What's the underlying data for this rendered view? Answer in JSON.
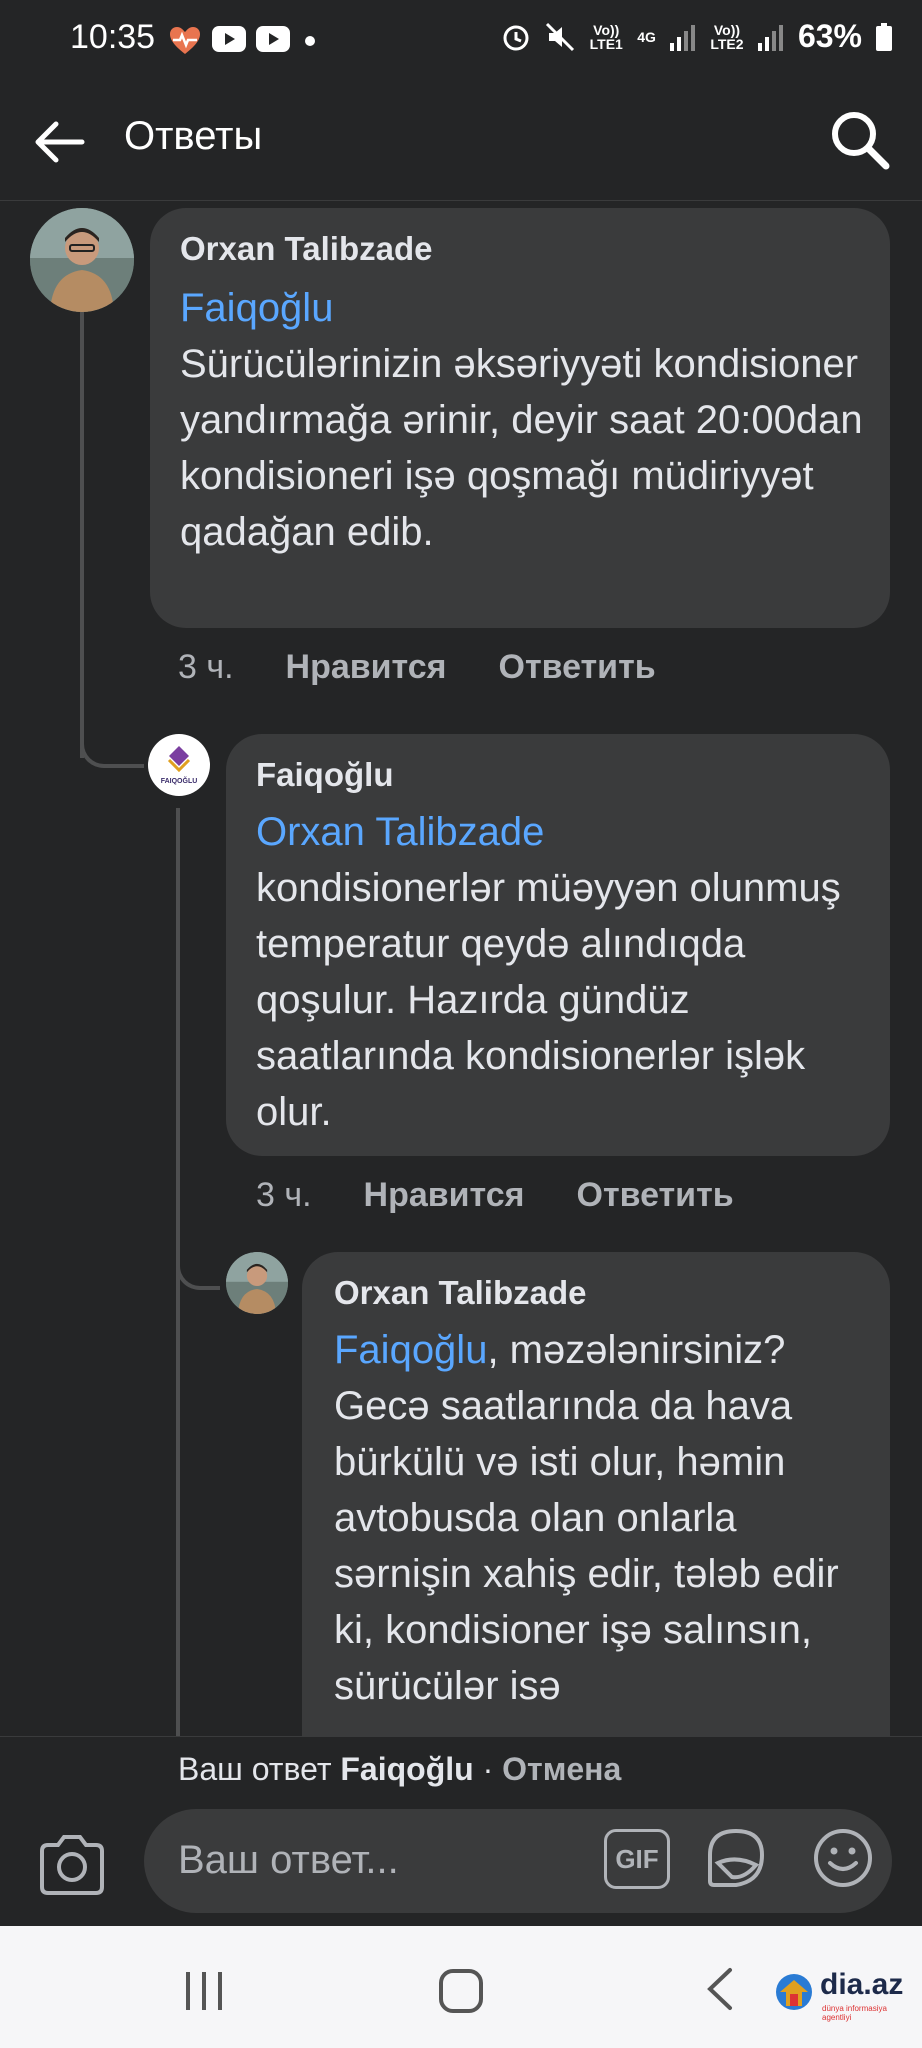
{
  "status_bar": {
    "time": "10:35",
    "battery": "63%",
    "sim1": "Vo)) LTE1",
    "sim2": "Vo)) LTE2",
    "network": "4G"
  },
  "header": {
    "title": "Ответы"
  },
  "comments": [
    {
      "author": "Orxan Talibzade",
      "mention": "Faiqoğlu",
      "text": "Sürücülərinizin əksəriyyəti kondisioner yandırmağa ərinir, deyir saat 20:00dan kondisioneri işə qoşmağı müdiriyyət qadağan edib.",
      "time": "3 ч.",
      "like": "Нравится",
      "reply": "Ответить"
    },
    {
      "author": "Faiqoğlu",
      "avatar_text": "FAIQOĞLU",
      "mention": "Orxan Talibzade",
      "text": "kondisionerlər müəyyən olunmuş temperatur qeydə alındıqda qoşulur. Hazırda gündüz saatlarında kondisionerlər işlək olur.",
      "time": "3 ч.",
      "like": "Нравится",
      "reply": "Ответить"
    },
    {
      "author": "Orxan Talibzade",
      "mention": "Faiqoğlu",
      "text": ", məzələnirsiniz? Gecə saatlarında da hava bürkülü və isti olur, həmin avtobusda olan onlarla sərnişin xahiş edir, tələb edir ki, kondisioner işə salınsın, sürücülər isə"
    }
  ],
  "reply_bar": {
    "prefix": "Ваш ответ",
    "target": "Faiqoğlu",
    "separator": " · ",
    "cancel": "Отмена",
    "placeholder": "Ваш ответ...",
    "gif_label": "GIF"
  },
  "watermark": {
    "text": "dia.az",
    "sub": "dünya informasiya agentliyi"
  },
  "colors": {
    "background": "#242526",
    "bubble": "#3a3b3c",
    "mention": "#5aa7ff",
    "secondary_text": "#b0b3b8"
  }
}
